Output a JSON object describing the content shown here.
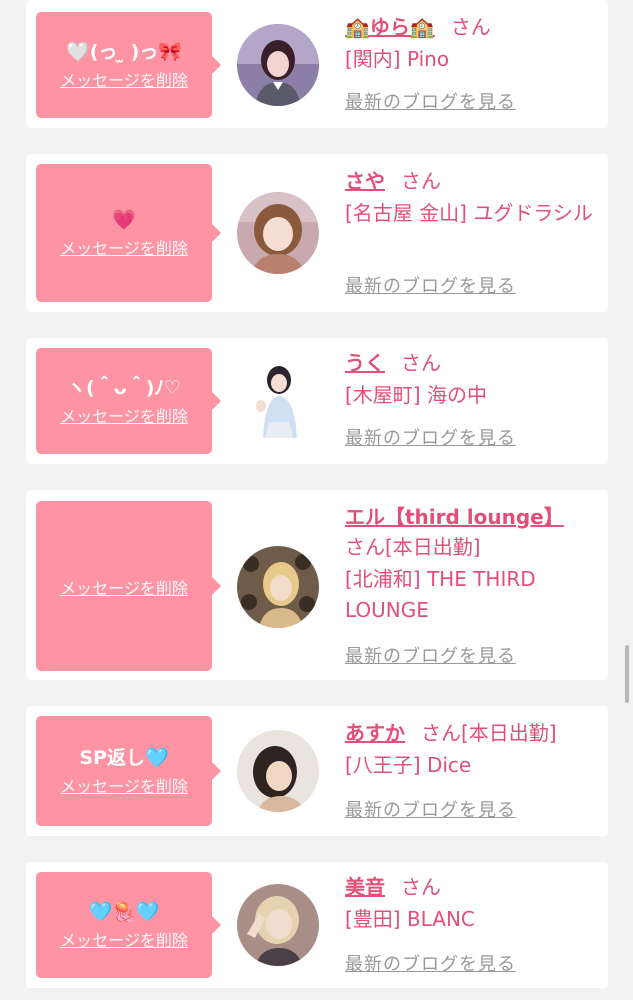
{
  "colors": {
    "accent": "#e44f78",
    "bubble": "#fe94a3",
    "link_gray": "#999999"
  },
  "cards": [
    {
      "message": "🤍(っ ̫ )っ🎀",
      "delete_label": "メッセージを削除",
      "name": "🏫ゆら🏫",
      "san": "さん",
      "shop": "[関内] Pino",
      "blog_label": "最新のブログを見る"
    },
    {
      "message": "💗",
      "delete_label": "メッセージを削除",
      "name": "さや",
      "san": "さん",
      "shop": "[名古屋 金山] ユグドラシル",
      "blog_label": "最新のブログを見る"
    },
    {
      "message": "ヽ(＾ᴗ＾)ﾉ♡",
      "delete_label": "メッセージを削除",
      "name": "うく",
      "san": "さん",
      "shop": "[木屋町] 海の中",
      "blog_label": "最新のブログを見る"
    },
    {
      "message": "",
      "delete_label": "メッセージを削除",
      "name": "エル【third lounge】",
      "san": "さん[本日出勤]",
      "shop": "[北浦和] THE THIRD LOUNGE",
      "blog_label": "最新のブログを見る"
    },
    {
      "message": "SP返し🩵",
      "delete_label": "メッセージを削除",
      "name": "あすか",
      "san": "さん[本日出勤]",
      "shop": "[八王子] Dice",
      "blog_label": "最新のブログを見る"
    },
    {
      "message": "🩵🪼🩵",
      "delete_label": "メッセージを削除",
      "name": "美音",
      "san": "さん",
      "shop": "[豊田] BLANC",
      "blog_label": "最新のブログを見る"
    }
  ]
}
